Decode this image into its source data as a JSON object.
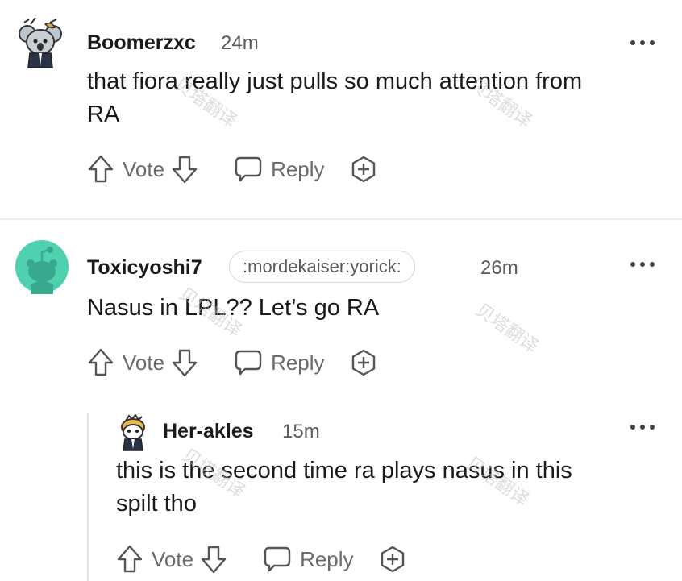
{
  "comments": [
    {
      "username": "Boomerzxc",
      "time": "24m",
      "body_line1": "that fiora really just pulls so much attention from",
      "body_line2": "RA"
    },
    {
      "username": "Toxicyoshi7",
      "flair": ":mordekaiser:yorick:",
      "time": "26m",
      "body_line1": "Nasus in LPL?? Let’s go RA",
      "body_line2": ""
    },
    {
      "username": "Her-akles",
      "time": "15m",
      "body_line1": "this is the second time ra plays nasus in this",
      "body_line2": "spilt tho"
    }
  ],
  "actions": {
    "vote_label": "Vote",
    "reply_label": "Reply"
  },
  "icons": {
    "upvote": "arrow-up-icon",
    "downvote": "arrow-down-icon",
    "reply": "speech-bubble-icon",
    "award": "plus-circle-icon",
    "more": "ellipsis-icon"
  },
  "colors": {
    "accent_avatar": "#4fd1b0",
    "text": "#1a1a1b",
    "muted": "#6a6a6a"
  },
  "watermark": "贝塔翻译"
}
